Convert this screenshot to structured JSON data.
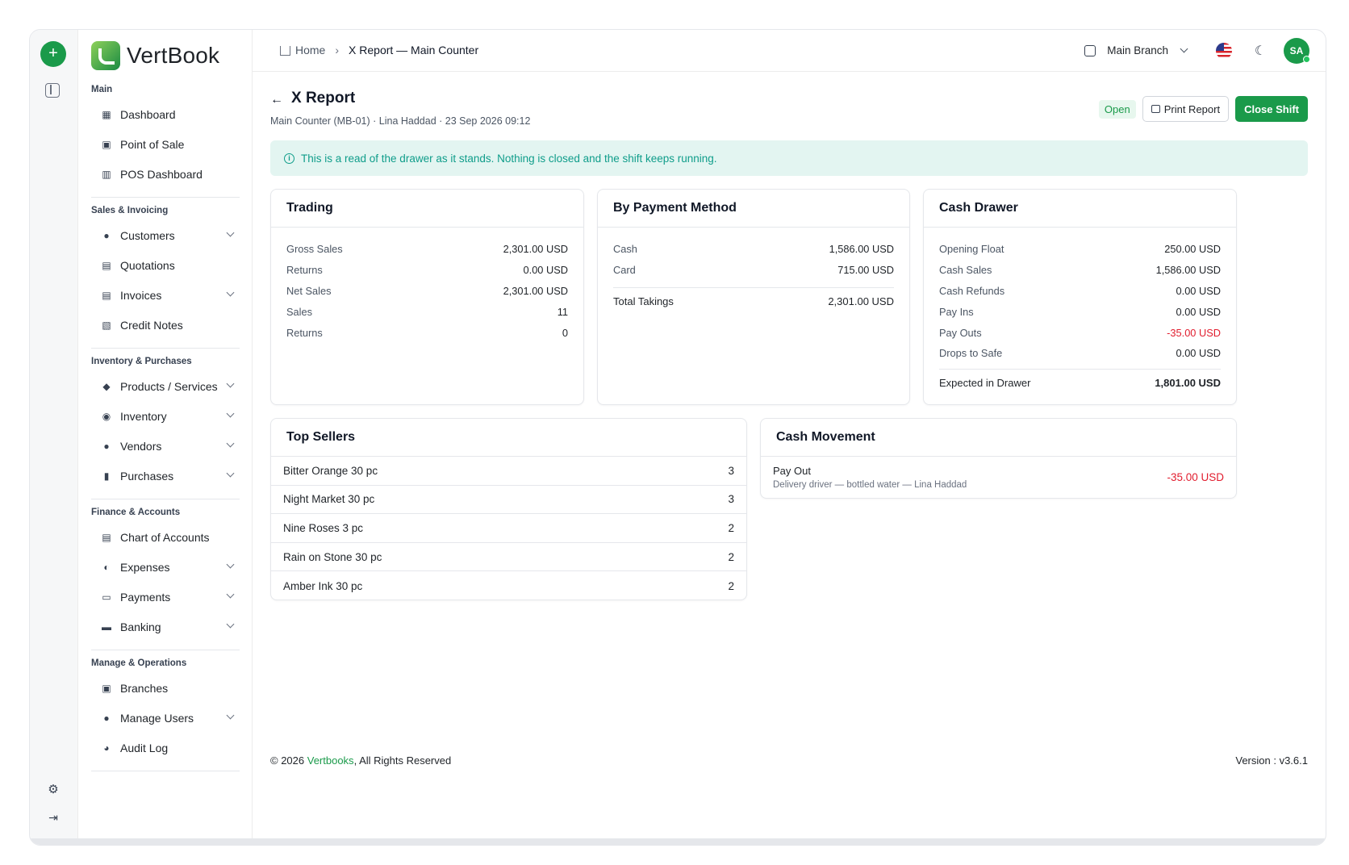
{
  "brand": {
    "name": "VertBook"
  },
  "sidebar": {
    "sections": [
      {
        "title": "Main",
        "items": [
          {
            "label": "Dashboard",
            "icon": "dashboard-icon"
          },
          {
            "label": "Point of Sale",
            "icon": "store-icon"
          },
          {
            "label": "POS Dashboard",
            "icon": "bar-chart-icon"
          }
        ]
      },
      {
        "title": "Sales & Invoicing",
        "items": [
          {
            "label": "Customers",
            "icon": "users-icon",
            "expandable": true
          },
          {
            "label": "Quotations",
            "icon": "quote-icon"
          },
          {
            "label": "Invoices",
            "icon": "invoice-icon",
            "expandable": true
          },
          {
            "label": "Credit Notes",
            "icon": "credit-note-icon"
          }
        ]
      },
      {
        "title": "Inventory & Purchases",
        "items": [
          {
            "label": "Products / Services",
            "icon": "box-icon",
            "expandable": true
          },
          {
            "label": "Inventory",
            "icon": "inventory-icon",
            "expandable": true
          },
          {
            "label": "Vendors",
            "icon": "vendors-icon",
            "expandable": true
          },
          {
            "label": "Purchases",
            "icon": "bag-icon",
            "expandable": true
          }
        ]
      },
      {
        "title": "Finance & Accounts",
        "items": [
          {
            "label": "Chart of Accounts",
            "icon": "ledger-icon"
          },
          {
            "label": "Expenses",
            "icon": "expense-icon",
            "expandable": true
          },
          {
            "label": "Payments",
            "icon": "payments-icon",
            "expandable": true
          },
          {
            "label": "Banking",
            "icon": "bank-icon",
            "expandable": true
          }
        ]
      },
      {
        "title": "Manage & Operations",
        "items": [
          {
            "label": "Branches",
            "icon": "branch-icon"
          },
          {
            "label": "Manage Users",
            "icon": "users-icon",
            "expandable": true
          },
          {
            "label": "Audit Log",
            "icon": "audit-icon"
          }
        ]
      }
    ]
  },
  "topbar": {
    "breadcrumb_home": "Home",
    "breadcrumb_current": "X Report — Main Counter",
    "branch": "Main Branch",
    "avatar_initials": "SA"
  },
  "page": {
    "title": "X Report",
    "subtitle": "Main Counter (MB-01) · Lina Haddad · 23 Sep 2026 09:12",
    "status": "Open",
    "print_label": "Print Report",
    "close_label": "Close Shift",
    "notice": "This is a read of the drawer as it stands. Nothing is closed and the shift keeps running."
  },
  "trading": {
    "title": "Trading",
    "rows": [
      {
        "label": "Gross Sales",
        "value": "2,301.00 USD"
      },
      {
        "label": "Returns",
        "value": "0.00 USD"
      },
      {
        "label": "Net Sales",
        "value": "2,301.00 USD"
      },
      {
        "label": "Sales",
        "value": "11"
      },
      {
        "label": "Returns",
        "value": "0"
      }
    ]
  },
  "payment": {
    "title": "By Payment Method",
    "rows": [
      {
        "label": "Cash",
        "value": "1,586.00 USD"
      },
      {
        "label": "Card",
        "value": "715.00 USD"
      }
    ],
    "total_label": "Total Takings",
    "total_value": "2,301.00 USD"
  },
  "drawer": {
    "title": "Cash Drawer",
    "rows": [
      {
        "label": "Opening Float",
        "value": "250.00 USD"
      },
      {
        "label": "Cash Sales",
        "value": "1,586.00 USD"
      },
      {
        "label": "Cash Refunds",
        "value": "0.00 USD"
      },
      {
        "label": "Pay Ins",
        "value": "0.00 USD"
      },
      {
        "label": "Pay Outs",
        "value": "-35.00 USD",
        "negative": true
      },
      {
        "label": "Drops to Safe",
        "value": "0.00 USD"
      }
    ],
    "total_label": "Expected in Drawer",
    "total_value": "1,801.00 USD"
  },
  "top_sellers": {
    "title": "Top Sellers",
    "rows": [
      {
        "name": "Bitter Orange 30 pc",
        "qty": "3"
      },
      {
        "name": "Night Market 30 pc",
        "qty": "3"
      },
      {
        "name": "Nine Roses 3 pc",
        "qty": "2"
      },
      {
        "name": "Rain on Stone 30 pc",
        "qty": "2"
      },
      {
        "name": "Amber Ink 30 pc",
        "qty": "2"
      }
    ]
  },
  "cash_movement": {
    "title": "Cash Movement",
    "rows": [
      {
        "type": "Pay Out",
        "detail": "Delivery driver — bottled water — Lina Haddad",
        "amount": "-35.00 USD"
      }
    ]
  },
  "footer": {
    "copy_prefix": "© 2026 ",
    "company": "Vertbooks",
    "copy_suffix": ", All Rights Reserved",
    "version": "Version : v3.6.1"
  },
  "colors": {
    "brand_green": "#1a9a4a",
    "negative": "#e11d2e",
    "notice_text": "#0f9d8a",
    "notice_bg": "#e3f5f1"
  }
}
